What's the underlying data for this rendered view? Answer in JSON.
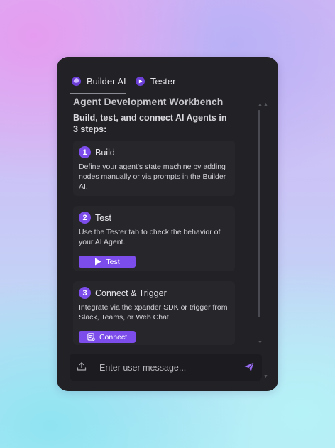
{
  "tabs": [
    {
      "label": "Builder AI",
      "icon": "brain-icon",
      "active": true
    },
    {
      "label": "Tester",
      "icon": "play-circle-icon",
      "active": false
    }
  ],
  "workbench": {
    "title": "Agent Development Workbench",
    "subtitle": "Build, test, and connect AI Agents in 3 steps:"
  },
  "steps": [
    {
      "number": "1",
      "title": "Build",
      "description": "Define your agent's state machine by adding nodes manually or via prompts in the Builder AI."
    },
    {
      "number": "2",
      "title": "Test",
      "description": "Use the Tester tab to check the behavior of your AI Agent.",
      "button_label": "Test",
      "button_icon": "play-icon"
    },
    {
      "number": "3",
      "title": "Connect & Trigger",
      "description": "Integrate via the xpander SDK or trigger from Slack, Teams, or Web Chat.",
      "button_label": "Connect",
      "button_icon": "connect-icon"
    }
  ],
  "composer": {
    "placeholder": "Enter user message...",
    "upload_icon": "upload-icon",
    "send_icon": "send-icon"
  },
  "colors": {
    "accent": "#7c4dea",
    "panel": "#222226",
    "card": "#26262b"
  }
}
